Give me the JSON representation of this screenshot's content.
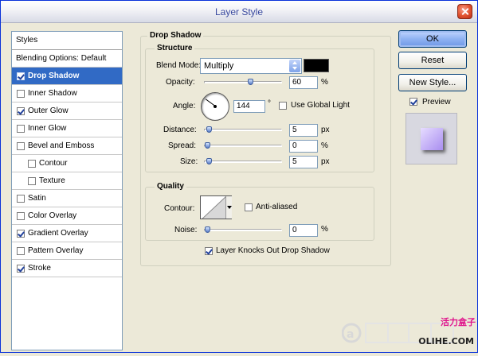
{
  "window": {
    "title": "Layer Style"
  },
  "styles_panel": {
    "header": "Styles",
    "blending_options": "Blending Options: Default",
    "items": [
      {
        "label": "Drop Shadow",
        "checked": true,
        "selected": true,
        "indent": false
      },
      {
        "label": "Inner Shadow",
        "checked": false,
        "selected": false,
        "indent": false
      },
      {
        "label": "Outer Glow",
        "checked": true,
        "selected": false,
        "indent": false
      },
      {
        "label": "Inner Glow",
        "checked": false,
        "selected": false,
        "indent": false
      },
      {
        "label": "Bevel and Emboss",
        "checked": false,
        "selected": false,
        "indent": false
      },
      {
        "label": "Contour",
        "checked": false,
        "selected": false,
        "indent": true
      },
      {
        "label": "Texture",
        "checked": false,
        "selected": false,
        "indent": true
      },
      {
        "label": "Satin",
        "checked": false,
        "selected": false,
        "indent": false
      },
      {
        "label": "Color Overlay",
        "checked": false,
        "selected": false,
        "indent": false
      },
      {
        "label": "Gradient Overlay",
        "checked": true,
        "selected": false,
        "indent": false
      },
      {
        "label": "Pattern Overlay",
        "checked": false,
        "selected": false,
        "indent": false
      },
      {
        "label": "Stroke",
        "checked": true,
        "selected": false,
        "indent": false
      }
    ]
  },
  "drop_shadow": {
    "title": "Drop Shadow",
    "structure": {
      "title": "Structure",
      "blend_mode_label": "Blend Mode:",
      "blend_mode_value": "Multiply",
      "shadow_color": "#000000",
      "opacity_label": "Opacity:",
      "opacity_value": "60",
      "opacity_unit": "%",
      "opacity_fraction": 0.6,
      "angle_label": "Angle:",
      "angle_value": "144",
      "angle_unit": "°",
      "use_global_light_label": "Use Global Light",
      "use_global_light_checked": false,
      "distance_label": "Distance:",
      "distance_value": "5",
      "distance_unit": "px",
      "distance_fraction": 0.02,
      "spread_label": "Spread:",
      "spread_value": "0",
      "spread_unit": "%",
      "spread_fraction": 0.0,
      "size_label": "Size:",
      "size_value": "5",
      "size_unit": "px",
      "size_fraction": 0.02
    },
    "quality": {
      "title": "Quality",
      "contour_label": "Contour:",
      "anti_aliased_label": "Anti-aliased",
      "anti_aliased_checked": false,
      "noise_label": "Noise:",
      "noise_value": "0",
      "noise_unit": "%",
      "noise_fraction": 0.0
    },
    "knocks_out_label": "Layer Knocks Out Drop Shadow",
    "knocks_out_checked": true
  },
  "buttons": {
    "ok": "OK",
    "reset": "Reset",
    "new_style": "New Style...",
    "preview_label": "Preview",
    "preview_checked": true
  },
  "watermark": {
    "brand_cn": "活力盒子",
    "brand_en": "OLIHE.COM"
  }
}
